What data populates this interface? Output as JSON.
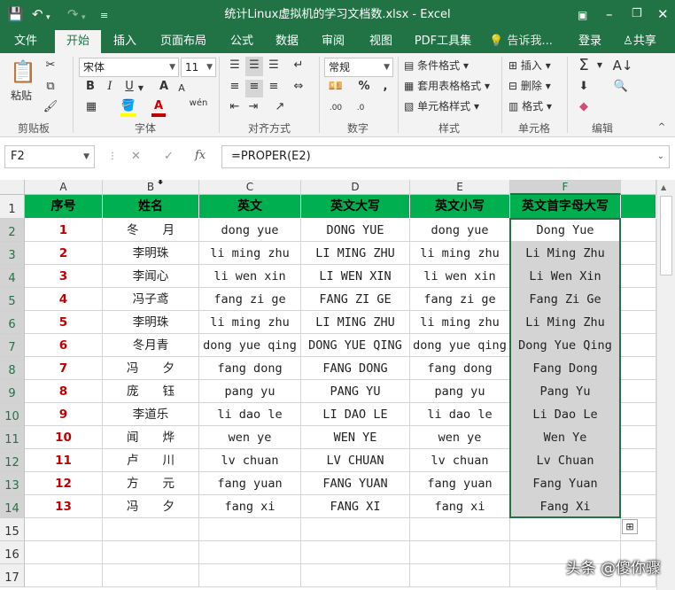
{
  "window": {
    "title": "统计Linux虚拟机的学习文档数.xlsx - Excel"
  },
  "tabs": [
    "文件",
    "开始",
    "插入",
    "页面布局",
    "公式",
    "数据",
    "审阅",
    "视图",
    "PDF工具集"
  ],
  "active_tab": "开始",
  "tell_me": "告诉我...",
  "login": "登录",
  "share": "共享",
  "ribbon": {
    "clipboard": {
      "label": "剪贴板",
      "paste": "粘贴"
    },
    "font": {
      "label": "字体",
      "name": "宋体",
      "size": "11",
      "bold": "B",
      "italic": "I",
      "underline": "U",
      "font_a": "A",
      "grow": "A",
      "shrink": "A",
      "wen": "wén"
    },
    "alignment": {
      "label": "对齐方式"
    },
    "number": {
      "label": "数字",
      "format": "常规",
      "percent": "%",
      "comma": ",",
      "inc": ".00",
      "dec": ".0"
    },
    "styles": {
      "label": "样式",
      "cond": "条件格式",
      "table": "套用表格格式",
      "cell": "单元格样式"
    },
    "cells": {
      "label": "单元格",
      "insert": "插入",
      "delete": "删除",
      "format": "格式"
    },
    "editing": {
      "label": "编辑",
      "sigma": "Σ"
    }
  },
  "formula_bar": {
    "name_box": "F2",
    "formula": "=PROPER(E2)",
    "fx": "fx",
    "cancel": "✕",
    "confirm": "✓"
  },
  "columns": [
    "A",
    "B",
    "C",
    "D",
    "E",
    "F"
  ],
  "rows": [
    "1",
    "2",
    "3",
    "4",
    "5",
    "6",
    "7",
    "8",
    "9",
    "10",
    "11",
    "12",
    "13",
    "14",
    "15",
    "16",
    "17"
  ],
  "header_row": [
    "序号",
    "姓名",
    "英文",
    "英文大写",
    "英文小写",
    "英文首字母大写"
  ],
  "data_rows": [
    [
      "1",
      "冬　　月",
      "dong yue",
      "DONG YUE",
      "dong yue",
      "Dong Yue"
    ],
    [
      "2",
      "李明珠",
      "li ming zhu",
      "LI MING ZHU",
      "li ming zhu",
      "Li Ming Zhu"
    ],
    [
      "3",
      "李闻心",
      "li wen xin",
      "LI WEN XIN",
      "li wen xin",
      "Li Wen Xin"
    ],
    [
      "4",
      "冯子鸢",
      "fang zi ge",
      "FANG ZI GE",
      "fang zi ge",
      "Fang Zi Ge"
    ],
    [
      "5",
      "李明珠",
      "li ming zhu",
      "LI MING ZHU",
      "li ming zhu",
      "Li Ming Zhu"
    ],
    [
      "6",
      "冬月青",
      "dong yue qing",
      "DONG YUE QING",
      "dong yue qing",
      "Dong Yue Qing"
    ],
    [
      "7",
      "冯　　夕",
      "fang dong",
      "FANG DONG",
      "fang dong",
      "Fang Dong"
    ],
    [
      "8",
      "庞　　钰",
      "pang yu",
      "PANG YU",
      "pang yu",
      "Pang Yu"
    ],
    [
      "9",
      "李道乐",
      "li dao le",
      "LI DAO LE",
      "li dao le",
      "Li Dao Le"
    ],
    [
      "10",
      "闻　　烨",
      "wen ye",
      "WEN YE",
      "wen ye",
      "Wen Ye"
    ],
    [
      "11",
      "卢　　川",
      "lv chuan",
      "LV CHUAN",
      "lv chuan",
      "Lv Chuan"
    ],
    [
      "12",
      "方　　元",
      "fang yuan",
      "FANG YUAN",
      "fang yuan",
      "Fang Yuan"
    ],
    [
      "13",
      "冯　　夕",
      "fang xi",
      "FANG XI",
      "fang xi",
      "Fang Xi"
    ]
  ],
  "watermark": "头条 @傻你骤",
  "colors": {
    "title_bar": "#217346",
    "header_fill": "#00b050",
    "number_red": "#c00000",
    "selection": "#d4d4d4"
  }
}
